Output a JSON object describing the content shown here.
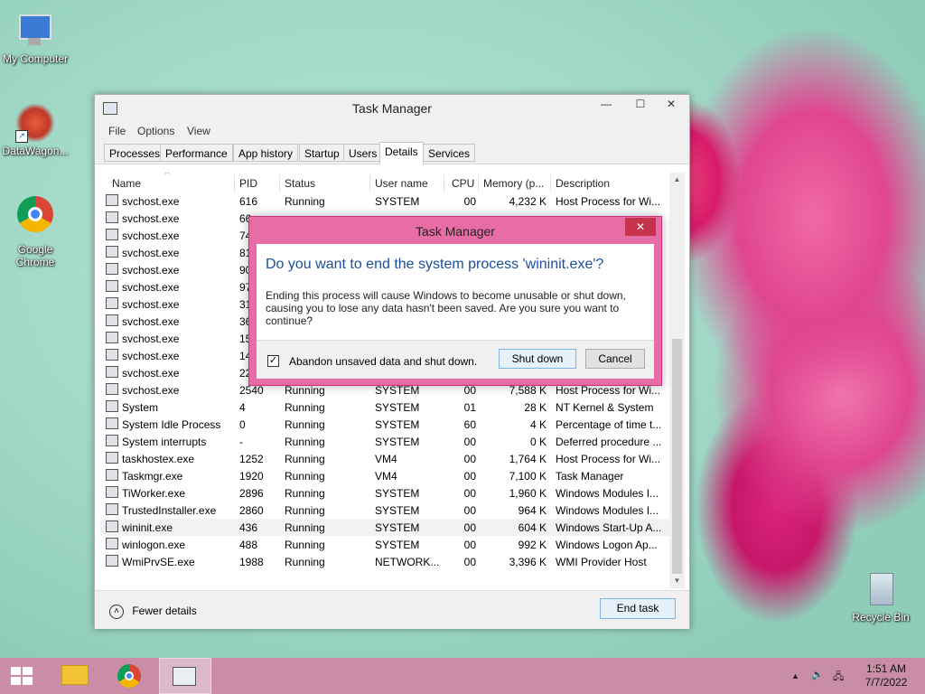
{
  "desktop": {
    "icons": [
      {
        "label": "My Computer"
      },
      {
        "label": "DataWagon..."
      },
      {
        "label": "Google Chrome"
      },
      {
        "label": "Recycle Bin"
      }
    ]
  },
  "taskmgr": {
    "title": "Task Manager",
    "menu": [
      "File",
      "Options",
      "View"
    ],
    "tabs": [
      "Processes",
      "Performance",
      "App history",
      "Startup",
      "Users",
      "Details",
      "Services"
    ],
    "active_tab": "Details",
    "columns": [
      "Name",
      "PID",
      "Status",
      "User name",
      "CPU",
      "Memory (p...",
      "Description"
    ],
    "rows": [
      {
        "name": "svchost.exe",
        "pid": "616",
        "status": "Running",
        "user": "SYSTEM",
        "cpu": "00",
        "mem": "4,232 K",
        "desc": "Host Process for Wi..."
      },
      {
        "name": "svchost.exe",
        "pid": "66",
        "status": "",
        "user": "",
        "cpu": "",
        "mem": "",
        "desc": ""
      },
      {
        "name": "svchost.exe",
        "pid": "74",
        "status": "",
        "user": "",
        "cpu": "",
        "mem": "",
        "desc": ""
      },
      {
        "name": "svchost.exe",
        "pid": "81",
        "status": "",
        "user": "",
        "cpu": "",
        "mem": "",
        "desc": ""
      },
      {
        "name": "svchost.exe",
        "pid": "90",
        "status": "",
        "user": "",
        "cpu": "",
        "mem": "",
        "desc": ""
      },
      {
        "name": "svchost.exe",
        "pid": "97",
        "status": "",
        "user": "",
        "cpu": "",
        "mem": "",
        "desc": ""
      },
      {
        "name": "svchost.exe",
        "pid": "31",
        "status": "",
        "user": "",
        "cpu": "",
        "mem": "",
        "desc": ""
      },
      {
        "name": "svchost.exe",
        "pid": "36",
        "status": "",
        "user": "",
        "cpu": "",
        "mem": "",
        "desc": ""
      },
      {
        "name": "svchost.exe",
        "pid": "15",
        "status": "",
        "user": "",
        "cpu": "",
        "mem": "",
        "desc": ""
      },
      {
        "name": "svchost.exe",
        "pid": "14",
        "status": "",
        "user": "",
        "cpu": "",
        "mem": "",
        "desc": ""
      },
      {
        "name": "svchost.exe",
        "pid": "22",
        "status": "",
        "user": "",
        "cpu": "",
        "mem": "",
        "desc": ""
      },
      {
        "name": "svchost.exe",
        "pid": "2540",
        "status": "Running",
        "user": "SYSTEM",
        "cpu": "00",
        "mem": "7,588 K",
        "desc": "Host Process for Wi..."
      },
      {
        "name": "System",
        "pid": "4",
        "status": "Running",
        "user": "SYSTEM",
        "cpu": "01",
        "mem": "28 K",
        "desc": "NT Kernel & System"
      },
      {
        "name": "System Idle Process",
        "pid": "0",
        "status": "Running",
        "user": "SYSTEM",
        "cpu": "60",
        "mem": "4 K",
        "desc": "Percentage of time t..."
      },
      {
        "name": "System interrupts",
        "pid": "-",
        "status": "Running",
        "user": "SYSTEM",
        "cpu": "00",
        "mem": "0 K",
        "desc": "Deferred procedure ..."
      },
      {
        "name": "taskhostex.exe",
        "pid": "1252",
        "status": "Running",
        "user": "VM4",
        "cpu": "00",
        "mem": "1,764 K",
        "desc": "Host Process for Wi..."
      },
      {
        "name": "Taskmgr.exe",
        "pid": "1920",
        "status": "Running",
        "user": "VM4",
        "cpu": "00",
        "mem": "7,100 K",
        "desc": "Task Manager"
      },
      {
        "name": "TiWorker.exe",
        "pid": "2896",
        "status": "Running",
        "user": "SYSTEM",
        "cpu": "00",
        "mem": "1,960 K",
        "desc": "Windows Modules I..."
      },
      {
        "name": "TrustedInstaller.exe",
        "pid": "2860",
        "status": "Running",
        "user": "SYSTEM",
        "cpu": "00",
        "mem": "964 K",
        "desc": "Windows Modules I..."
      },
      {
        "name": "wininit.exe",
        "pid": "436",
        "status": "Running",
        "user": "SYSTEM",
        "cpu": "00",
        "mem": "604 K",
        "desc": "Windows Start-Up A..."
      },
      {
        "name": "winlogon.exe",
        "pid": "488",
        "status": "Running",
        "user": "SYSTEM",
        "cpu": "00",
        "mem": "992 K",
        "desc": "Windows Logon Ap..."
      },
      {
        "name": "WmiPrvSE.exe",
        "pid": "1988",
        "status": "Running",
        "user": "NETWORK...",
        "cpu": "00",
        "mem": "3,396 K",
        "desc": "WMI Provider Host"
      }
    ],
    "selected_row": "wininit.exe",
    "fewer_details": "Fewer details",
    "end_task": "End task"
  },
  "dialog": {
    "title": "Task Manager",
    "close_glyph": "✕",
    "heading": "Do you want to end the system process 'wininit.exe'?",
    "message": "Ending this process will cause Windows to become unusable or shut down, causing you to lose any data hasn't been saved. Are you sure you want to continue?",
    "checkbox_label": "Abandon unsaved data and shut down.",
    "checkbox_checked": true,
    "shutdown_button": "Shut down",
    "cancel_button": "Cancel"
  },
  "taskbar": {
    "time": "1:51 AM",
    "date": "7/7/2022"
  },
  "icons": {
    "window_min": "—",
    "window_max": "☐",
    "window_close": "✕",
    "sort_arrow": "^",
    "chevron_up": "˄",
    "scroll_up": "▲",
    "scroll_down": "▼",
    "checkmark": "✓",
    "tray_up": "▲",
    "tray_volume": "🔈",
    "tray_network": "🖧"
  }
}
